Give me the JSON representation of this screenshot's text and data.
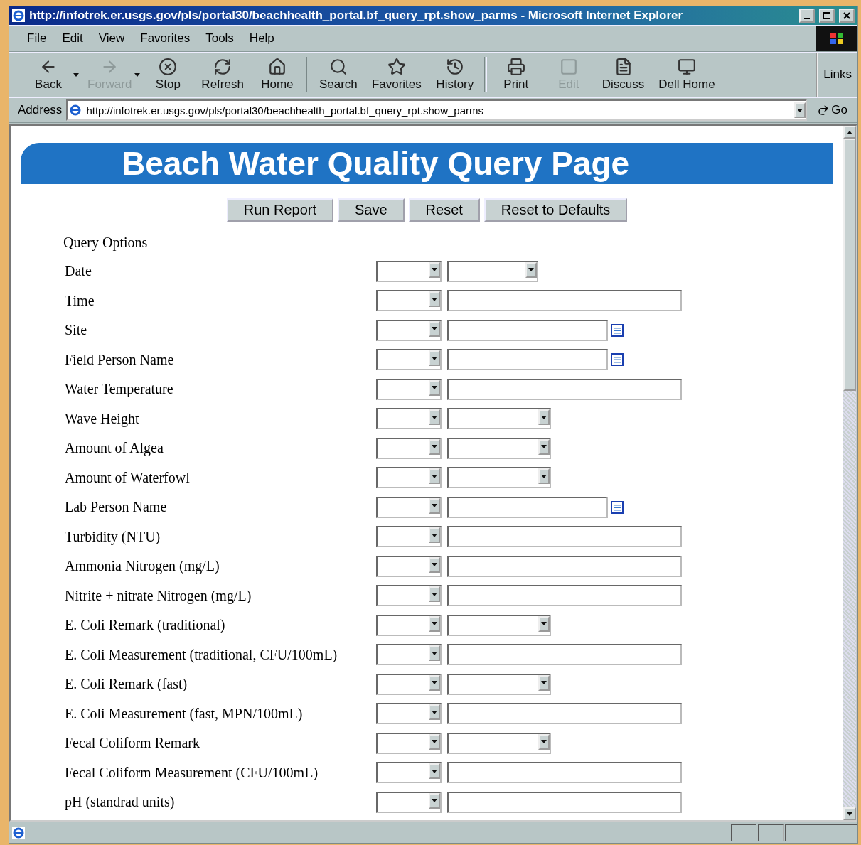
{
  "window": {
    "title": "http://infotrek.er.usgs.gov/pls/portal30/beachhealth_portal.bf_query_rpt.show_parms - Microsoft Internet Explorer"
  },
  "menu": [
    "File",
    "Edit",
    "View",
    "Favorites",
    "Tools",
    "Help"
  ],
  "toolbar": [
    {
      "label": "Back",
      "kind": "back",
      "disabled": false,
      "dropdown": true
    },
    {
      "label": "Forward",
      "kind": "forward",
      "disabled": true,
      "dropdown": true
    },
    {
      "label": "Stop",
      "kind": "stop",
      "disabled": false,
      "dropdown": false
    },
    {
      "label": "Refresh",
      "kind": "refresh",
      "disabled": false,
      "dropdown": false
    },
    {
      "label": "Home",
      "kind": "home",
      "disabled": false,
      "dropdown": false
    },
    {
      "label": "Search",
      "kind": "search",
      "disabled": false,
      "dropdown": false,
      "group_start": true
    },
    {
      "label": "Favorites",
      "kind": "favorites",
      "disabled": false,
      "dropdown": false
    },
    {
      "label": "History",
      "kind": "history",
      "disabled": false,
      "dropdown": false
    },
    {
      "label": "Print",
      "kind": "print",
      "disabled": false,
      "dropdown": false,
      "group_start": true
    },
    {
      "label": "Edit",
      "kind": "edit",
      "disabled": true,
      "dropdown": false
    },
    {
      "label": "Discuss",
      "kind": "discuss",
      "disabled": false,
      "dropdown": false
    },
    {
      "label": "Dell Home",
      "kind": "dell",
      "disabled": false,
      "dropdown": false
    }
  ],
  "links_label": "Links",
  "address": {
    "label": "Address",
    "value": "http://infotrek.er.usgs.gov/pls/portal30/beachhealth_portal.bf_query_rpt.show_parms",
    "go": "Go"
  },
  "page": {
    "heading": "Beach Water Quality Query Page",
    "buttons": [
      "Run Report",
      "Save",
      "Reset",
      "Reset to Defaults"
    ],
    "section_label": "Query Options",
    "rows": [
      {
        "label": "Date",
        "kind": "date"
      },
      {
        "label": "Time",
        "kind": "text"
      },
      {
        "label": "Site",
        "kind": "lookup"
      },
      {
        "label": "Field Person Name",
        "kind": "lookup"
      },
      {
        "label": "Water Temperature",
        "kind": "text"
      },
      {
        "label": "Wave Height",
        "kind": "select"
      },
      {
        "label": "Amount of Algea",
        "kind": "select"
      },
      {
        "label": "Amount of Waterfowl",
        "kind": "select"
      },
      {
        "label": "Lab Person Name",
        "kind": "lookup"
      },
      {
        "label": "Turbidity (NTU)",
        "kind": "text"
      },
      {
        "label": "Ammonia Nitrogen (mg/L)",
        "kind": "text"
      },
      {
        "label": "Nitrite + nitrate Nitrogen (mg/L)",
        "kind": "text"
      },
      {
        "label": "E. Coli Remark (traditional)",
        "kind": "select"
      },
      {
        "label": "E. Coli Measurement (traditional, CFU/100mL)",
        "kind": "text"
      },
      {
        "label": "E. Coli Remark (fast)",
        "kind": "select"
      },
      {
        "label": "E. Coli Measurement (fast, MPN/100mL)",
        "kind": "text"
      },
      {
        "label": "Fecal Coliform Remark",
        "kind": "select"
      },
      {
        "label": "Fecal Coliform Measurement (CFU/100mL)",
        "kind": "text"
      },
      {
        "label": "pH (standrad units)",
        "kind": "text"
      }
    ]
  }
}
